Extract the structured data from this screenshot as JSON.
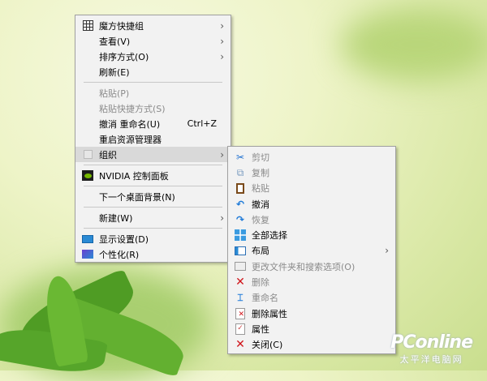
{
  "main_menu": [
    {
      "label": "魔方快捷组",
      "icon": "grid-icon",
      "submenu": true
    },
    {
      "label": "查看(V)",
      "submenu": true
    },
    {
      "label": "排序方式(O)",
      "submenu": true
    },
    {
      "label": "刷新(E)"
    },
    {
      "sep": true
    },
    {
      "label": "粘贴(P)",
      "disabled": true
    },
    {
      "label": "粘贴快捷方式(S)",
      "disabled": true
    },
    {
      "label": "撤消 重命名(U)",
      "shortcut": "Ctrl+Z"
    },
    {
      "label": "重启资源管理器"
    },
    {
      "label": "组织",
      "submenu": true,
      "highlighted": true
    },
    {
      "sep": true
    },
    {
      "label": "NVIDIA 控制面板"
    },
    {
      "sep": true
    },
    {
      "label": "下一个桌面背景(N)"
    },
    {
      "sep": true
    },
    {
      "label": "新建(W)",
      "submenu": true
    },
    {
      "sep": true
    },
    {
      "label": "显示设置(D)"
    },
    {
      "label": "个性化(R)"
    }
  ],
  "sub_menu": [
    {
      "label": "剪切",
      "disabled": true
    },
    {
      "label": "复制",
      "disabled": true
    },
    {
      "label": "粘贴",
      "disabled": true
    },
    {
      "label": "撤消"
    },
    {
      "label": "恢复",
      "disabled": true
    },
    {
      "label": "全部选择"
    },
    {
      "label": "布局",
      "submenu": true
    },
    {
      "label": "更改文件夹和搜索选项(O)",
      "disabled": true
    },
    {
      "label": "删除",
      "disabled": true
    },
    {
      "label": "重命名",
      "disabled": true
    },
    {
      "label": "删除属性"
    },
    {
      "label": "属性"
    },
    {
      "label": "关闭(C)"
    }
  ],
  "watermark": {
    "brand": "PConline",
    "sub": "太平洋电脑网"
  },
  "arrow": "›"
}
